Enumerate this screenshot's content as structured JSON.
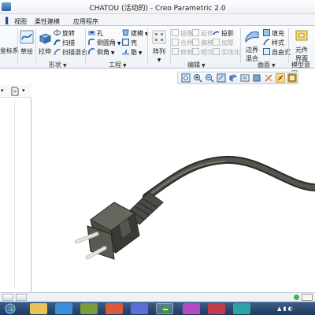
{
  "window": {
    "title": "CHATOU (活动的) - Creo Parametric 2.0"
  },
  "tabs": [
    {
      "label": "视图"
    },
    {
      "label": "柔性建模"
    },
    {
      "label": "应用程序"
    }
  ],
  "ribbon": {
    "datum": {
      "coord_label": "坐标系"
    },
    "sketch": {
      "label": "草绘"
    },
    "shapes": {
      "extrude": "拉伸",
      "revolve": "旋转",
      "sweep": "扫描",
      "swept_blend": "扫描混合",
      "group_label": "形状"
    },
    "engineering": {
      "hole": "孔",
      "round": "倒圆角",
      "chamfer": "倒角",
      "draft": "拔模",
      "shell": "壳",
      "rib": "筋",
      "group_label": "工程"
    },
    "pattern": {
      "label": "阵列"
    },
    "editing": {
      "mirror": "镜像",
      "extend": "延伸",
      "project": "投影",
      "merge": "合并",
      "trim": "修剪",
      "offset": "偏移",
      "intersect": "相交",
      "thicken": "加厚",
      "solidify": "实体化",
      "group_label": "编辑"
    },
    "surfaces": {
      "boundary_blend_l1": "边界",
      "boundary_blend_l2": "混合",
      "fill": "填充",
      "style": "样式",
      "freestyle": "自由式",
      "group_label": "曲面"
    },
    "model_intent": {
      "component_l1": "元件",
      "component_l2": "界面",
      "group_label": "模型意图"
    }
  },
  "left_panel": {
    "label": ""
  },
  "colors": {
    "ribbon_bg": "#eef2f6",
    "tab_border": "#b7c3d1",
    "taskbar": "#1f3a5e",
    "active_button": "#f6d98a",
    "plug_body": "#4b4b45",
    "cable": "#3f3f3a",
    "prong": "#d8d8d4"
  },
  "icons": [
    "app-menu-icon",
    "sketch-icon",
    "extrude-icon",
    "revolve-icon",
    "sweep-icon",
    "hole-icon",
    "round-icon",
    "chamfer-icon",
    "draft-icon",
    "shell-icon",
    "rib-icon",
    "pattern-icon",
    "zoom-icon",
    "refit-icon",
    "shading-icon",
    "start-icon"
  ]
}
